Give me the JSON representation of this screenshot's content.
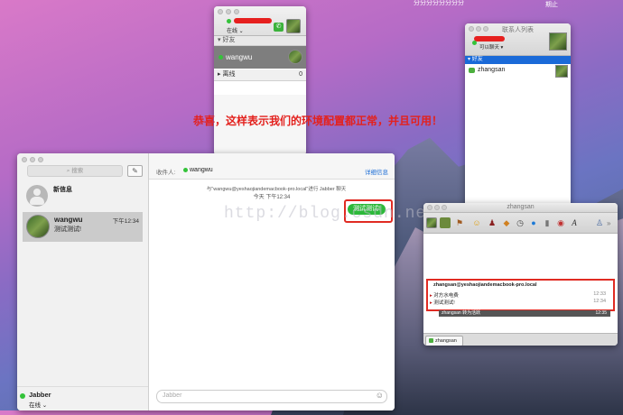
{
  "desktop": {
    "top_label_1": "分分分分分分分分",
    "top_label_2": "期止"
  },
  "buddy_window": {
    "status": "在线",
    "groups": [
      {
        "name": "好友",
        "count": ""
      },
      {
        "name": "离线",
        "count": "0"
      }
    ],
    "contact": "wangwu"
  },
  "contact_list": {
    "title": "联系人列表",
    "status": "可以聊天",
    "group": "好友",
    "contact": "zhangsan"
  },
  "annotation": "恭喜，这样表示我们的环境配置都正常，并且可用！",
  "messages_window": {
    "search_placeholder": "搜索",
    "new_message": "新信息",
    "conversation": {
      "name": "wangwu",
      "time": "下午12:34",
      "preview": "测试测试!"
    },
    "account": {
      "name": "Jabber",
      "status": "在线"
    },
    "to_label": "收件人:",
    "recipient": "wangwu",
    "details": "详细信息",
    "session_info": "与\"wangwu@yeshaojiandemacbook-pro.local\"进行 Jabber 聊天",
    "time_info": "今天 下午12:34",
    "bubble": "测试测试!",
    "input_placeholder": "Jabber"
  },
  "chat_window": {
    "title": "zhangsan",
    "sender": "zhangsan@yeshaojiandemacbook-pro.local",
    "lines": [
      {
        "text": "对方水电费",
        "time": "12:33"
      },
      {
        "text": "测试测试!",
        "time": "12:34"
      }
    ],
    "status_line": "zhangsan 转为活跃",
    "status_time": "12:35",
    "tab": "zhangsan"
  },
  "watermark": "http://blog.csdn.net/"
}
